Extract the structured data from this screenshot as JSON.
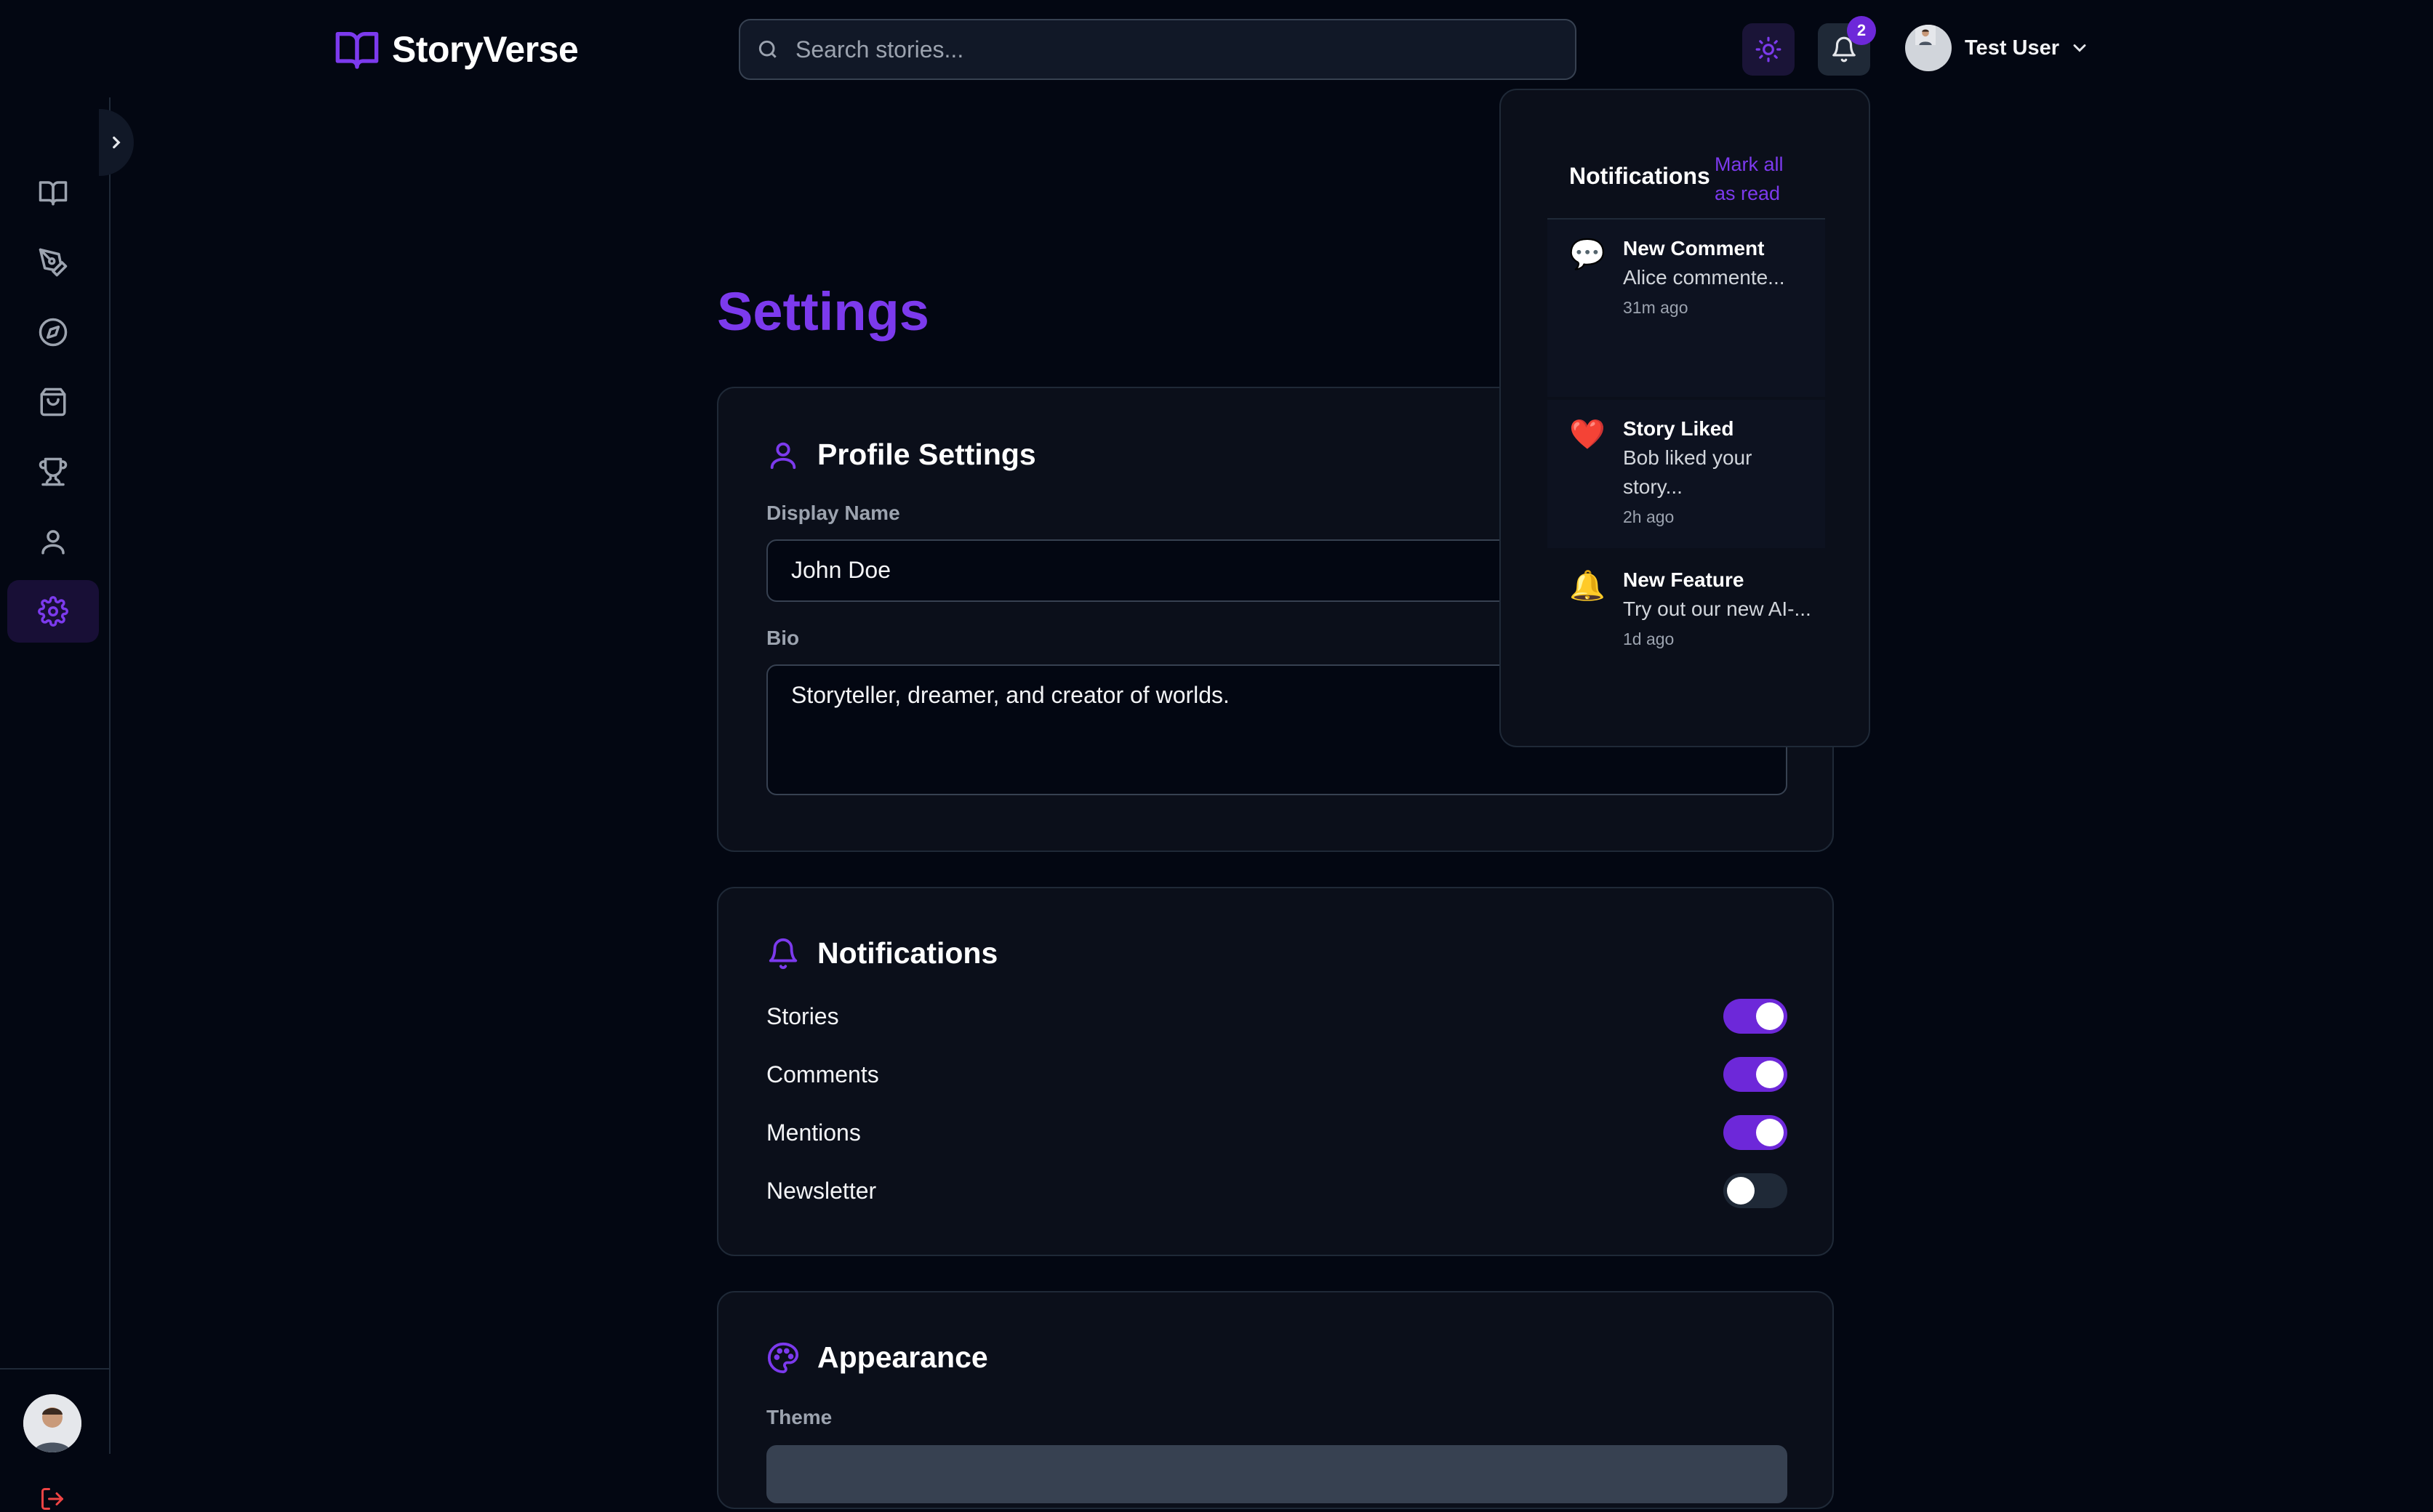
{
  "app": {
    "name": "StoryVerse"
  },
  "search": {
    "placeholder": "Search stories..."
  },
  "header": {
    "notification_count": "2",
    "user_name": "Test User"
  },
  "page": {
    "title": "Settings"
  },
  "profile": {
    "title": "Profile Settings",
    "display_name_label": "Display Name",
    "display_name_value": "John Doe",
    "bio_label": "Bio",
    "bio_value": "Storyteller, dreamer, and creator of worlds."
  },
  "notifications_settings": {
    "title": "Notifications",
    "toggles": [
      {
        "label": "Stories",
        "on": true
      },
      {
        "label": "Comments",
        "on": true
      },
      {
        "label": "Mentions",
        "on": true
      },
      {
        "label": "Newsletter",
        "on": false
      }
    ]
  },
  "appearance": {
    "title": "Appearance",
    "theme_label": "Theme"
  },
  "notif_panel": {
    "title": "Notifications",
    "mark_all_read": "Mark all as read",
    "items": [
      {
        "icon": "💬",
        "title": "New Comment",
        "message": "Alice commente...",
        "time": "31m ago"
      },
      {
        "icon": "❤️",
        "title": "Story Liked",
        "message": "Bob liked your story...",
        "time": "2h ago"
      },
      {
        "icon": "🔔",
        "title": "New Feature",
        "message": "Try out our new AI-...",
        "time": "1d ago"
      }
    ]
  },
  "colors": {
    "accent": "#7c3aed",
    "background": "#030712",
    "card": "#0b0f1a",
    "logout": "#ef4444"
  }
}
